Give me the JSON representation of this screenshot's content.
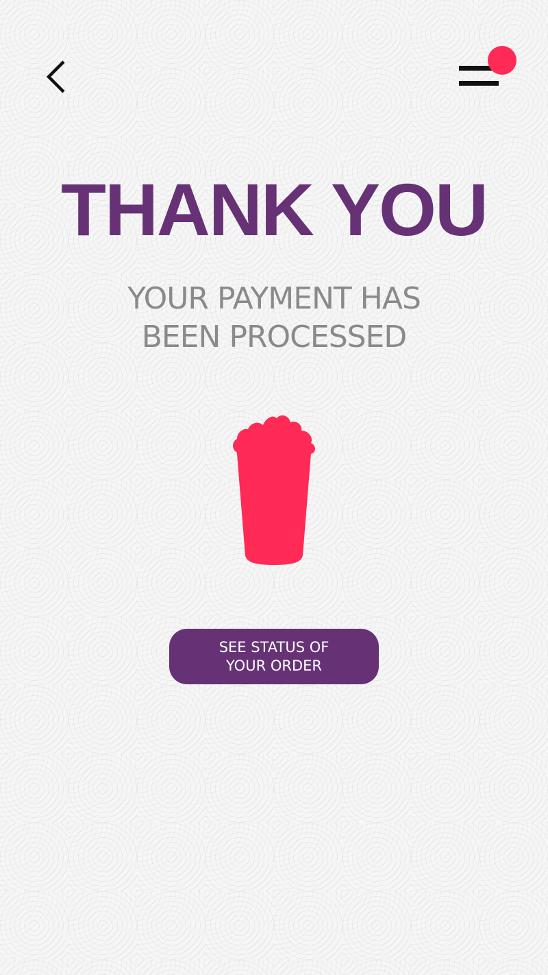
{
  "header": {
    "back_icon": "chevron-left-icon",
    "menu_icon": "hamburger-menu-icon",
    "has_notification": true
  },
  "main": {
    "title": "THANK YOU",
    "subtitle_line1": "YOUR PAYMENT HAS",
    "subtitle_line2": "BEEN PROCESSED",
    "illustration": "drink-cup-icon"
  },
  "action": {
    "button_line1": "SEE STATUS OF",
    "button_line2": "YOUR ORDER"
  },
  "colors": {
    "brand_purple": "#663275",
    "accent_pink": "#ff2a55",
    "subtitle_gray": "#8a8a8a",
    "background": "#f6f6f6"
  }
}
